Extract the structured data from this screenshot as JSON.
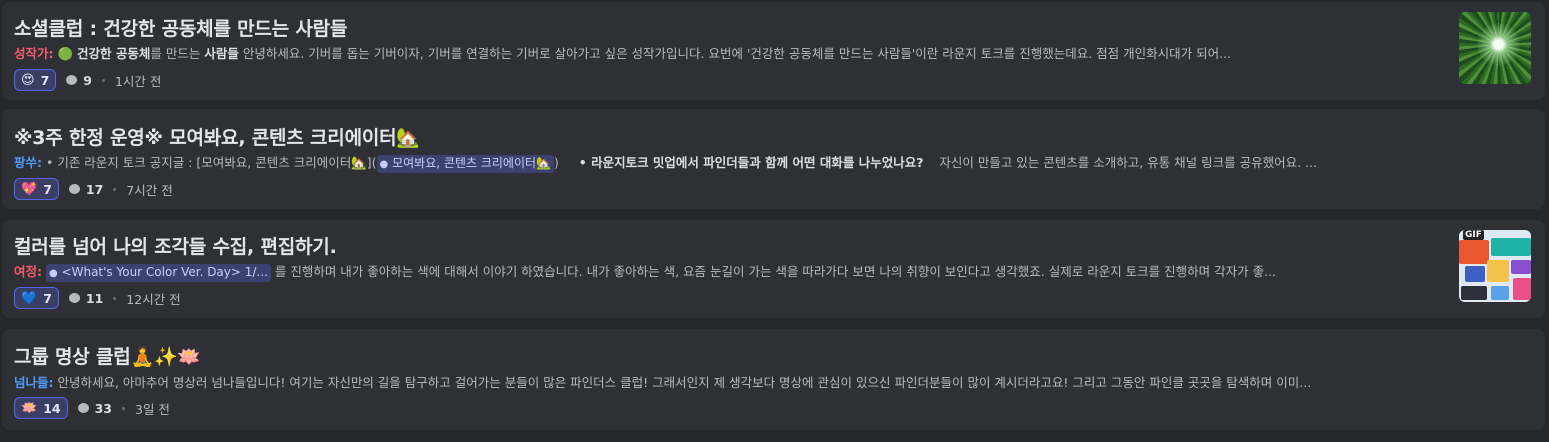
{
  "colors": {
    "background": "#26272b",
    "card": "#2f3036",
    "accent": "#5865f2",
    "chip": "#3c4270"
  },
  "posts": [
    {
      "title": "소셜클럽 : 건강한 공동체를 만드는 사람들",
      "author": "성작가:",
      "author_color": "#f25c6c",
      "preview_icon": "green-circle-emoji",
      "preview_glyph": "🟢",
      "preview_bold": "건강한 공동체",
      "preview_mid": "를 만드는 ",
      "preview_bold2": "사람들",
      "preview_rest": " 안녕하세요. 기버를 돕는 기버이자, 기버를 연결하는 기버로 살아가고 싶은 성작가입니다. 요번에 '건강한 공동체를 만드는 사람들'이란 라운지 토크를 진행했는데요. 점점 개인화시대가 되어...",
      "reaction_emoji": "😍",
      "reaction_count": "7",
      "comment_count": "9",
      "time": "1시간 전",
      "thumbnail": "bamboo-forest-image"
    },
    {
      "title": "※3주 한정 운영※ 모여봐요, 콘텐츠 크리에이터🏡",
      "author": "팡쑤:",
      "author_color": "#4f9cf7",
      "preview_lead": "• 기존 라운지 토크 공지글 : [모여봐요, 콘텐츠 크리에이터🏡](",
      "preview_chip": "모여봐요, 콘텐츠 크리에이터🏡",
      "preview_close": ")",
      "preview_bold": "• 라운지토크 밋업에서 파인더들과 함께 어떤 대화를 나누었나요?",
      "preview_rest": "자신이 만들고 있는 콘텐츠를 소개하고, 유통 채널 링크를 공유했어요. ...",
      "reaction_emoji": "💖",
      "reaction_count": "7",
      "comment_count": "17",
      "time": "7시간 전"
    },
    {
      "title": "컬러를 넘어 나의 조각들 수집, 편집하기.",
      "author": "여정:",
      "author_color": "#f25c6c",
      "preview_chip": "<What's Your Color Ver. Day> 1/...",
      "preview_rest": " 를 진행하며 내가 좋아하는 색에 대해서 이야기 하였습니다. 내가 좋아하는 색, 요즘 눈길이 가는 색을 따라가다 보면 나의 취향이 보인다고 생각했죠. 실제로 라운지 토크를 진행하며 각자가 좋...",
      "reaction_emoji": "💙",
      "reaction_count": "7",
      "comment_count": "11",
      "time": "12시간 전",
      "thumbnail": "color-collage-gif",
      "thumb_badge": "GIF"
    },
    {
      "title": "그룹 명상 클럽🧘✨🪷",
      "author": "넘나들:",
      "author_color": "#4f9cf7",
      "preview_rest": " 안녕하세요, 아마추어 명상러 넘나들입니다! 여기는 자신만의 길을 탐구하고 걸어가는 분들이 많은 파인더스 클럽! 그래서인지 제 생각보다 명상에 관심이 있으신 파인더분들이 많이 계시더라고요! 그리고 그동안 파인클 곳곳을 탐색하며 이미...",
      "reaction_emoji": "🪷",
      "reaction_count": "14",
      "comment_count": "33",
      "time": "3일 전"
    }
  ]
}
